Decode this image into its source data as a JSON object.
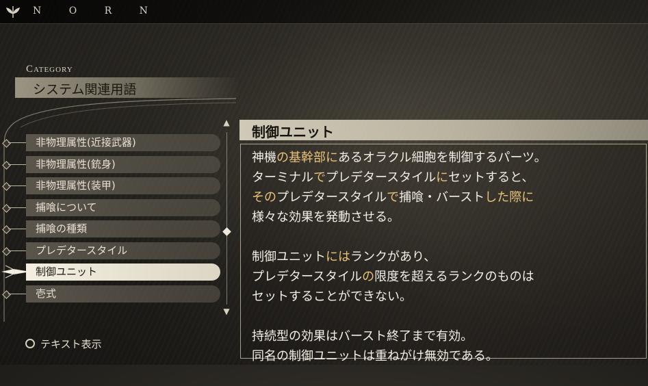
{
  "header": {
    "brand": "N O R N"
  },
  "category": {
    "label": "Category",
    "title": "システム関連用語"
  },
  "menu": {
    "items": [
      {
        "label": "非物理属性(近接武器)",
        "selected": false
      },
      {
        "label": "非物理属性(銃身)",
        "selected": false
      },
      {
        "label": "非物理属性(装甲)",
        "selected": false
      },
      {
        "label": "捕喰について",
        "selected": false
      },
      {
        "label": "捕喰の種類",
        "selected": false
      },
      {
        "label": "プレデタースタイル",
        "selected": false
      },
      {
        "label": "制御ユニット",
        "selected": true
      },
      {
        "label": "壱式",
        "selected": false
      }
    ]
  },
  "detail": {
    "title": "制御ユニット",
    "paragraphs": [
      [
        [
          {
            "t": "神機",
            "hl": false
          },
          {
            "t": "の基幹部に",
            "hl": true
          },
          {
            "t": "ある",
            "hl": false
          },
          {
            "t": "オラクル細胞",
            "hl": false
          },
          {
            "t": "を制御するパーツ。",
            "hl": false
          }
        ],
        [
          {
            "t": "ターミナル",
            "hl": false
          },
          {
            "t": "で",
            "hl": true
          },
          {
            "t": "プレデタースタイル",
            "hl": false
          },
          {
            "t": "に",
            "hl": true
          },
          {
            "t": "セットすると、",
            "hl": false
          }
        ],
        [
          {
            "t": "その",
            "hl": true
          },
          {
            "t": "プレデタースタイル",
            "hl": false
          },
          {
            "t": "で",
            "hl": true
          },
          {
            "t": "捕喰・バースト",
            "hl": false
          },
          {
            "t": "した際に",
            "hl": true
          }
        ],
        [
          {
            "t": "様々な効果を発動させる。",
            "hl": false
          }
        ]
      ],
      [
        [
          {
            "t": "制御ユニット",
            "hl": false
          },
          {
            "t": "には",
            "hl": true
          },
          {
            "t": "ランクがあり、",
            "hl": false
          }
        ],
        [
          {
            "t": "プレデタースタイル",
            "hl": false
          },
          {
            "t": "の",
            "hl": true
          },
          {
            "t": "限度を超えるランクのものは",
            "hl": false
          }
        ],
        [
          {
            "t": "セットすることができない。",
            "hl": false
          }
        ]
      ],
      [
        [
          {
            "t": "持続型の効果は",
            "hl": false
          },
          {
            "t": "バースト",
            "hl": false
          },
          {
            "t": "終了まで有効。",
            "hl": false
          }
        ],
        [
          {
            "t": "同名の",
            "hl": false
          },
          {
            "t": "制御ユニット",
            "hl": false
          },
          {
            "t": "は重ねがけ無効である。",
            "hl": false
          }
        ]
      ]
    ]
  },
  "footer": {
    "hint_label": "テキスト表示",
    "hint_button_icon": "circle-button-icon"
  },
  "colors": {
    "highlight": "#e8c27a",
    "text": "#f2eee4",
    "selected_bg": "#f3eee0"
  }
}
